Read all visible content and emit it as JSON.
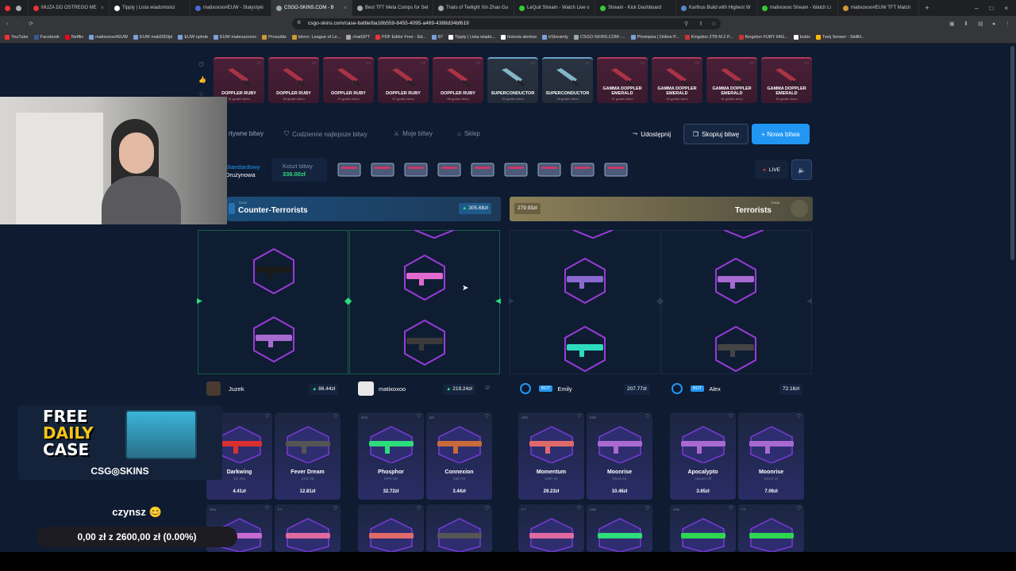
{
  "browser": {
    "tabs": [
      "MUZA DO OSTREGO ME",
      "Tipply | Lista wiadomości",
      "matixoxoo#EUW - Statystyki",
      "CSGO-SKINS.COM - B",
      "Best TFT Meta Comps for Set",
      "Trials of Twilight Xin Zhao Gu",
      "LeQuit Stream - Watch Live o",
      "Stream - Kick Dashboard",
      "Karthus Build with Highest W",
      "matixoxoo Stream - Watch Li",
      "matixoxoo#EUW TFT Match"
    ],
    "url": "csgo-skins.com/case-battle/ba18b559-8455-4095-a469-4388d34bf619",
    "bookmarks": [
      "YouTube",
      "Facebook",
      "Netflix",
      "matixoxoo#EUW",
      "EUW mati2003pl",
      "EUW ophob",
      "EUW mateuszxxxx",
      "Proxuilds",
      "lolvvv: League of Le...",
      "chatGPT",
      "PDF Editor Free - Ed...",
      "87",
      "Tipply | Lista wiado...",
      "historia alertow",
      "irStreamly",
      "CSGO-SKINS.COM -...",
      "Photopea | Online P...",
      "Kingston 2TB M.2 P...",
      "Kingston FURY 64G...",
      "bobix",
      "Twój Serwer - SkillH..."
    ]
  },
  "drops": [
    {
      "name": "DOPPLER RUBY",
      "time": "31 godzin temu"
    },
    {
      "name": "DOPPLER RUBY",
      "time": "35 godzin temu"
    },
    {
      "name": "DOPPLER RUBY",
      "time": "37 godzin temu"
    },
    {
      "name": "DOPPLER RUBY",
      "time": "87 godzin temu"
    },
    {
      "name": "DOPPLER RUBY",
      "time": "98 godzin temu"
    },
    {
      "name": "SUPERCONDUCTOR",
      "time": "33 godzin temu"
    },
    {
      "name": "SUPERCONDUCTOR",
      "time": "33 godzin temu"
    },
    {
      "name": "GAMMA DOPPLER EMERALD",
      "time": "21 godzin temu"
    },
    {
      "name": "GAMMA DOPPLER EMERALD",
      "time": "35 godzin temu"
    },
    {
      "name": "GAMMA DOPPLER EMERALD",
      "time": "41 godzin temu"
    },
    {
      "name": "GAMMA DOPPLER EMERALD",
      "time": "46 godzin temu"
    }
  ],
  "nav": {
    "active": "rtywne bitwy",
    "daily": "Codzienne najlepsze bitwy",
    "mine": "Moje bitwy",
    "shop": "Sklep"
  },
  "actions": {
    "share": "Udostępnij",
    "copy": "Skopiuj bitwę",
    "new": "+ Nowa bitwa",
    "live": "LIVE"
  },
  "battle": {
    "mode1": "Standardowy",
    "mode2": "Drużynowa",
    "cost_label": "Koszt bitwy",
    "cost": "336.00zł"
  },
  "teams": {
    "ct": {
      "label": "TEAM",
      "name": "Counter-Terrorists",
      "value": "305.68zł"
    },
    "t": {
      "label": "TEAM",
      "name": "Terrorists",
      "value": "279.93zł"
    }
  },
  "players": [
    {
      "name": "Juzek",
      "value": "86.44zł"
    },
    {
      "name": "matixoxoo",
      "value": "219.24zł"
    },
    {
      "badge": "BOT",
      "name": "Emily",
      "value": "207.77zł"
    },
    {
      "badge": "BOT",
      "name": "Alex",
      "value": "72.16zł"
    }
  ],
  "cards": [
    {
      "wear": "",
      "name": "Darkwing",
      "sub": "SG 553",
      "price": "4.41zł"
    },
    {
      "wear": "",
      "name": "Fever Dream",
      "sub": "SSG 08",
      "price": "12.81zł"
    },
    {
      "wear": "WW",
      "name": "Phosphor",
      "sub": "MP5-SD",
      "price": "32.72zł"
    },
    {
      "wear": "BS",
      "name": "Connexion",
      "sub": "Galil AR",
      "price": "3.44zł"
    },
    {
      "wear": "MW",
      "name": "Momentum",
      "sub": "UMP-45",
      "price": "29.23zł"
    },
    {
      "wear": "MW",
      "name": "Moonrise",
      "sub": "Glock-18",
      "price": "10.46zł"
    },
    {
      "wear": "",
      "name": "Apocalypto",
      "sub": "Sawed-Off",
      "price": "3.65zł"
    },
    {
      "wear": "",
      "name": "Moonrise",
      "sub": "Glock-18",
      "price": "7.06zł"
    }
  ],
  "cards_row2_wear": [
    "WW",
    "FT",
    "",
    "",
    "FT",
    "MW",
    "MW",
    "FT"
  ],
  "overlay": {
    "free1": "FREE",
    "free2": "DAILY",
    "free3": "CASE",
    "brand": "CSG◎SKINS",
    "goal_label": "czynsz",
    "goal_progress": "0,00 zł z 2600,00 zł (0.00%)"
  },
  "colors": {
    "accent": "#2196f3",
    "ct": "#1b4d7a",
    "t": "#8c8058",
    "green": "#2ddc7a",
    "pink": "#b23a5c"
  }
}
